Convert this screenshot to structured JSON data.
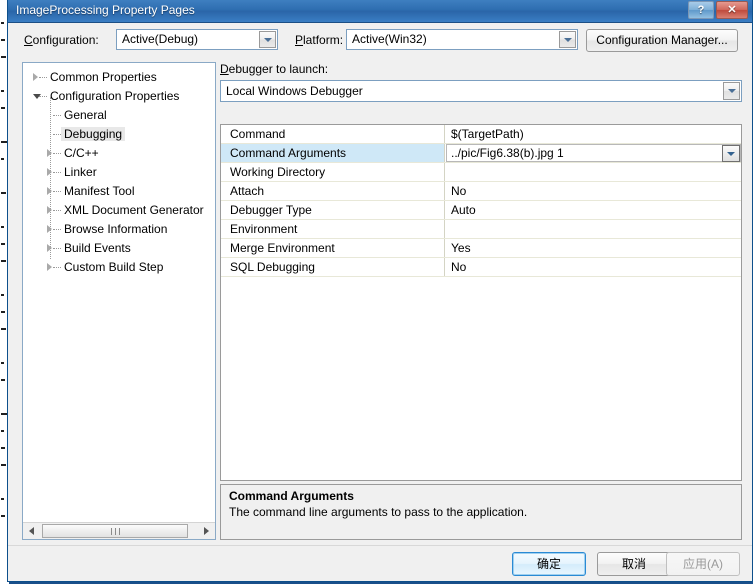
{
  "window": {
    "title": "ImageProcessing Property Pages",
    "help_button": "?",
    "close_button": "✕"
  },
  "config_bar": {
    "configuration_label": "Configuration:",
    "configuration_value": "Active(Debug)",
    "platform_label": "Platform:",
    "platform_value": "Active(Win32)",
    "configuration_manager_button": "Configuration Manager..."
  },
  "tree": {
    "items": [
      {
        "label": "Common Properties",
        "level": 0,
        "state": "collapsed",
        "selected": false
      },
      {
        "label": "Configuration Properties",
        "level": 0,
        "state": "expanded",
        "selected": false
      },
      {
        "label": "General",
        "level": 1,
        "state": "leaf",
        "selected": false
      },
      {
        "label": "Debugging",
        "level": 1,
        "state": "leaf",
        "selected": true
      },
      {
        "label": "C/C++",
        "level": 1,
        "state": "collapsed",
        "selected": false
      },
      {
        "label": "Linker",
        "level": 1,
        "state": "collapsed",
        "selected": false
      },
      {
        "label": "Manifest Tool",
        "level": 1,
        "state": "collapsed",
        "selected": false
      },
      {
        "label": "XML Document Generator",
        "level": 1,
        "state": "collapsed",
        "selected": false
      },
      {
        "label": "Browse Information",
        "level": 1,
        "state": "collapsed",
        "selected": false
      },
      {
        "label": "Build Events",
        "level": 1,
        "state": "collapsed",
        "selected": false
      },
      {
        "label": "Custom Build Step",
        "level": 1,
        "state": "collapsed",
        "selected": false
      }
    ]
  },
  "debugger": {
    "label": "Debugger to launch:",
    "value": "Local Windows Debugger"
  },
  "property_grid": {
    "rows": [
      {
        "name": "Command",
        "value": "$(TargetPath)",
        "selected": false
      },
      {
        "name": "Command Arguments",
        "value": "../pic/Fig6.38(b).jpg 1",
        "selected": true
      },
      {
        "name": "Working Directory",
        "value": "",
        "selected": false
      },
      {
        "name": "Attach",
        "value": "No",
        "selected": false
      },
      {
        "name": "Debugger Type",
        "value": "Auto",
        "selected": false
      },
      {
        "name": "Environment",
        "value": "",
        "selected": false
      },
      {
        "name": "Merge Environment",
        "value": "Yes",
        "selected": false
      },
      {
        "name": "SQL Debugging",
        "value": "No",
        "selected": false
      }
    ]
  },
  "description": {
    "title": "Command Arguments",
    "text": "The command line arguments to pass to the application."
  },
  "footer": {
    "ok_button": "确定",
    "cancel_button": "取消",
    "apply_button": "应用(A)"
  },
  "colors": {
    "titlebar_blue": "#2e6db0",
    "dialog_border": "#0d4f8b",
    "selection_blue": "#cfe8f7",
    "close_red": "#bf4a3c"
  }
}
